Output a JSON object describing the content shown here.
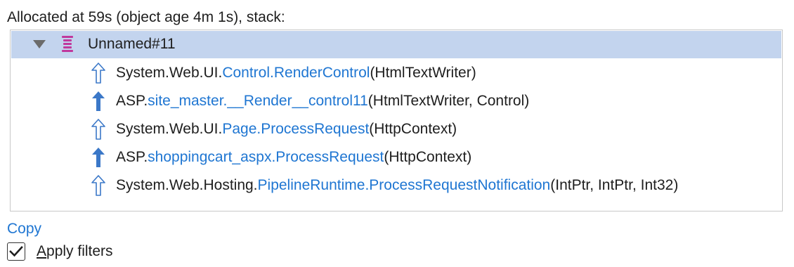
{
  "header": {
    "text": "Allocated at 59s (object age 4m 1s), stack:"
  },
  "tree": {
    "root": {
      "label": "Unnamed#11",
      "icon": "stack-icon",
      "expanded": true
    },
    "frames": [
      {
        "icon": "arrow-up-outline-icon",
        "prefix": "System.Web.UI.",
        "link": "Control.RenderControl",
        "args": "(HtmlTextWriter)"
      },
      {
        "icon": "arrow-up-filled-icon",
        "prefix": "ASP.",
        "link": "site_master.__Render__control11",
        "args": "(HtmlTextWriter, Control)"
      },
      {
        "icon": "arrow-up-outline-icon",
        "prefix": "System.Web.UI.",
        "link": "Page.ProcessRequest",
        "args": "(HttpContext)"
      },
      {
        "icon": "arrow-up-filled-icon",
        "prefix": "ASP.",
        "link": "shoppingcart_aspx.ProcessRequest",
        "args": "(HttpContext)"
      },
      {
        "icon": "arrow-up-outline-icon",
        "prefix": "System.Web.Hosting.",
        "link": "PipelineRuntime.ProcessRequestNotification",
        "args": "(IntPtr, IntPtr, Int32)"
      }
    ]
  },
  "actions": {
    "copy_label": "Copy"
  },
  "filters": {
    "apply_label_first": "A",
    "apply_label_rest": "pply filters",
    "checked": true
  },
  "colors": {
    "selection": "#c3d4ee",
    "link": "#1f76d2",
    "arrow": "#3b78c8",
    "stack_icon": "#c0399d"
  }
}
